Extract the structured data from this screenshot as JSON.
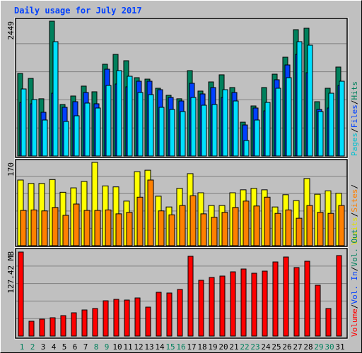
{
  "chart_data": [
    {
      "type": "bar",
      "panel": "top",
      "title": "Daily usage for July 2017",
      "ylabel_max": "2449",
      "ylim": [
        0,
        2449
      ],
      "grid": true,
      "categories": [
        "1",
        "2",
        "3",
        "4",
        "5",
        "6",
        "7",
        "8",
        "9",
        "10",
        "11",
        "12",
        "13",
        "14",
        "15",
        "16",
        "17",
        "18",
        "19",
        "20",
        "21",
        "22",
        "23",
        "24",
        "25",
        "26",
        "27",
        "28",
        "29",
        "30",
        "31"
      ],
      "series": [
        {
          "name": "Hits",
          "color": "#00805c",
          "values": [
            1500,
            1410,
            1040,
            2449,
            936,
            1090,
            1270,
            1167,
            1667,
            1846,
            1731,
            1423,
            1397,
            1231,
            1103,
            1040,
            1551,
            1180,
            1346,
            1475,
            1244,
            615,
            910,
            1244,
            1487,
            1795,
            2295,
            2321,
            987,
            1231,
            1616
          ]
        },
        {
          "name": "Files",
          "color": "#00e0ff",
          "values": [
            1218,
            1026,
            654,
            2077,
            628,
            731,
            962,
            872,
            1282,
            1551,
            1449,
            1154,
            1115,
            885,
            846,
            808,
            1064,
            923,
            936,
            1205,
            1000,
            282,
            654,
            974,
            1231,
            1423,
            2077,
            2013,
            808,
            1141,
            1359
          ]
        },
        {
          "name": "Pages",
          "color": "#0040ff",
          "values": [
            974,
            949,
            795,
            1141,
            885,
            987,
            1154,
            949,
            1577,
            1308,
            1257,
            1359,
            1359,
            1205,
            1064,
            1000,
            1321,
            1128,
            1244,
            1064,
            1154,
            564,
            872,
            820,
            1385,
            1654,
            1846,
            1513,
            846,
            872,
            1282
          ]
        }
      ]
    },
    {
      "type": "bar",
      "panel": "middle",
      "ylabel_max": "170",
      "ylim": [
        0,
        170
      ],
      "grid": true,
      "categories": [
        "1",
        "2",
        "3",
        "4",
        "5",
        "6",
        "7",
        "8",
        "9",
        "10",
        "11",
        "12",
        "13",
        "14",
        "15",
        "16",
        "17",
        "18",
        "19",
        "20",
        "21",
        "22",
        "23",
        "24",
        "25",
        "26",
        "27",
        "28",
        "29",
        "30",
        "31"
      ],
      "series": [
        {
          "name": "Visits",
          "color": "#ffff00",
          "values": [
            134,
            127,
            127,
            135,
            109,
            118,
            131,
            170,
            122,
            120,
            91,
            151,
            154,
            101,
            79,
            117,
            147,
            108,
            82,
            82,
            108,
            114,
            117,
            114,
            79,
            104,
            92,
            137,
            105,
            112,
            107
          ]
        },
        {
          "name": "Sites",
          "color": "#ff8000",
          "values": [
            72,
            73,
            71,
            78,
            62,
            85,
            72,
            72,
            73,
            65,
            68,
            99,
            134,
            71,
            63,
            82,
            102,
            65,
            58,
            68,
            78,
            91,
            81,
            99,
            66,
            73,
            56,
            82,
            68,
            66,
            82
          ]
        }
      ]
    },
    {
      "type": "bar",
      "panel": "bottom",
      "ylabel_max": "127.42 MB",
      "ylim": [
        0,
        127.42
      ],
      "grid": true,
      "categories": [
        "1",
        "2",
        "3",
        "4",
        "5",
        "6",
        "7",
        "8",
        "9",
        "10",
        "11",
        "12",
        "13",
        "14",
        "15",
        "16",
        "17",
        "18",
        "19",
        "20",
        "21",
        "22",
        "23",
        "24",
        "25",
        "26",
        "27",
        "28",
        "29",
        "30",
        "31"
      ],
      "series": [
        {
          "name": "Volume",
          "color": "#ff0000",
          "values": [
            127.42,
            22.5,
            25.7,
            27.8,
            31.0,
            35.3,
            39.6,
            41.8,
            53.5,
            55.7,
            54.6,
            57.8,
            43.9,
            66.4,
            65.3,
            70.7,
            121.0,
            84.6,
            88.9,
            91.0,
            97.4,
            101.7,
            95.3,
            98.5,
            112.4,
            119.9,
            103.9,
            113.5,
            77.1,
            41.8,
            122.1
          ]
        }
      ]
    }
  ],
  "legend": {
    "top": [
      {
        "label": "Pages",
        "color": "#00c0d0"
      },
      {
        "sep": "/"
      },
      {
        "label": "Files",
        "color": "#0040ff"
      },
      {
        "sep": "/"
      },
      {
        "label": "Hits",
        "color": "#00805c"
      }
    ],
    "middle": [
      {
        "label": "Visits",
        "color": "#e0e000"
      },
      {
        "sep": "/"
      },
      {
        "label": "Sites",
        "color": "#ff8000"
      },
      {
        "sep": "/"
      }
    ],
    "bottom": [
      {
        "label": "Volume",
        "color": "#ff0000"
      },
      {
        "sep": "/"
      },
      {
        "label": "Vol. In",
        "color": "#0040ff"
      },
      {
        "sep": "/"
      },
      {
        "label": "Vol. Out",
        "color": "#00805c"
      }
    ]
  },
  "weekend_days": [
    "1",
    "2",
    "8",
    "9",
    "15",
    "16",
    "22",
    "23",
    "29",
    "30"
  ],
  "colors": {
    "weekday_label": "#000000",
    "weekend_label": "#00805c",
    "grid": "#808080",
    "title": "#0040ff"
  }
}
